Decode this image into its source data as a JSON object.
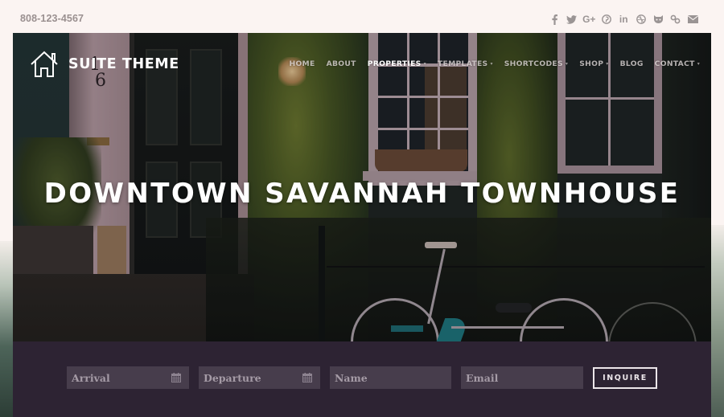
{
  "topbar": {
    "phone": "808-123-4567",
    "social_icons": [
      {
        "name": "facebook-icon",
        "glyph": "f"
      },
      {
        "name": "twitter-icon",
        "glyph": ""
      },
      {
        "name": "google-plus-icon",
        "glyph": "G+"
      },
      {
        "name": "pinterest-icon",
        "glyph": ""
      },
      {
        "name": "linkedin-icon",
        "glyph": "in"
      },
      {
        "name": "dribbble-icon",
        "glyph": ""
      },
      {
        "name": "github-icon",
        "glyph": ""
      },
      {
        "name": "link-icon",
        "glyph": ""
      },
      {
        "name": "email-icon",
        "glyph": ""
      }
    ]
  },
  "header": {
    "logo_icon": "house-icon",
    "site_title": "SUITE THEME",
    "nav": [
      {
        "label": "HOME",
        "dropdown": false,
        "active": false
      },
      {
        "label": "ABOUT",
        "dropdown": false,
        "active": false
      },
      {
        "label": "PROPERTIES",
        "dropdown": true,
        "active": true
      },
      {
        "label": "TEMPLATES",
        "dropdown": true,
        "active": false
      },
      {
        "label": "SHORTCODES",
        "dropdown": true,
        "active": false
      },
      {
        "label": "SHOP",
        "dropdown": true,
        "active": false
      },
      {
        "label": "BLOG",
        "dropdown": false,
        "active": false
      },
      {
        "label": "CONTACT",
        "dropdown": true,
        "active": false
      }
    ]
  },
  "hero": {
    "title": "DOWNTOWN SAVANNAH TOWNHOUSE",
    "image_description": "Ivy-covered townhouse facade with black door numbered 106, white-framed window, lantern, and bicycles parked by an iron fence"
  },
  "booking": {
    "arrival_placeholder": "Arrival",
    "departure_placeholder": "Departure",
    "name_placeholder": "Name",
    "email_placeholder": "Email",
    "submit_label": "INQUIRE",
    "calendar_icon": "calendar-icon"
  },
  "colors": {
    "booking_bar": "#2d2333",
    "field_bg": "#473d4c",
    "field_text": "#a59ba6",
    "page_bg": "#fbf4f2",
    "topbar_text": "#9a9090"
  }
}
